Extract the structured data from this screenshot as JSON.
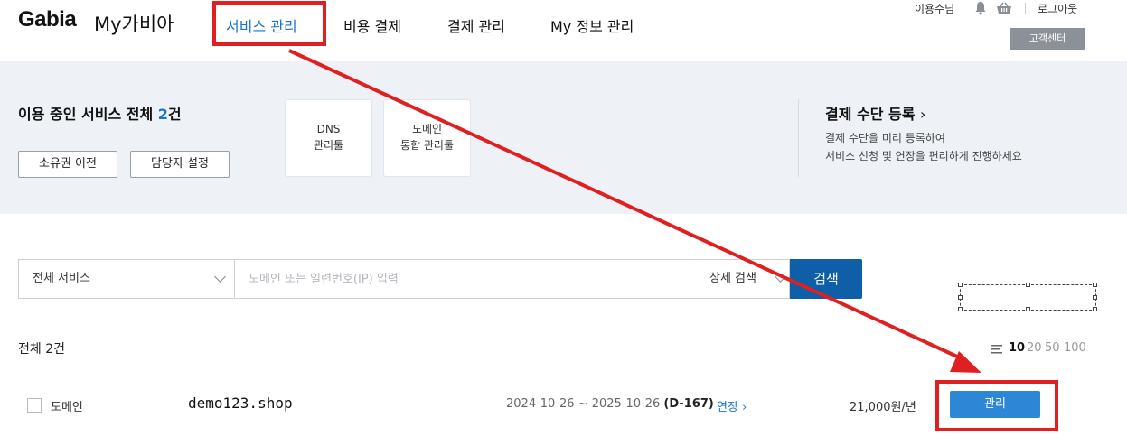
{
  "header": {
    "logo": "Gabia",
    "logo_sub": "My가비아",
    "nav": [
      {
        "label": "서비스 관리",
        "active": true
      },
      {
        "label": "비용 결제",
        "active": false
      },
      {
        "label": "결제 관리",
        "active": false
      },
      {
        "label": "My 정보 관리",
        "active": false
      }
    ],
    "user_name": "이용수님",
    "icons": [
      "bell-icon",
      "basket-icon"
    ],
    "logout": "로그아웃",
    "customer_center": "고객센터"
  },
  "summary": {
    "title_prefix": "이용 중인 서비스 전체 ",
    "count": "2",
    "title_suffix": "건",
    "buttons": [
      "소유권 이전",
      "담당자 설정"
    ],
    "tiles": [
      {
        "line1": "DNS",
        "line2": "관리툴"
      },
      {
        "line1": "도메인",
        "line2": "통합 관리툴"
      }
    ],
    "payment": {
      "title": "결제 수단 등록",
      "desc_line1": "결제 수단을 미리 등록하여",
      "desc_line2": "서비스 신청 및 연장을 편리하게 진행하세요"
    }
  },
  "search": {
    "service_select": "전체 서비스",
    "placeholder": "도메인 또는 일련번호(IP) 입력",
    "advanced": "상세 검색",
    "button": "검색"
  },
  "list": {
    "total": "전체 2건",
    "page_sizes": [
      "10",
      "20",
      "50",
      "100"
    ],
    "selected_page_size": "10",
    "rows": [
      {
        "type": "도메인",
        "domain": "demo123.shop",
        "period": "2024-10-26 ~ 2025-10-26",
        "dday": "(D-167)",
        "extend": "연장",
        "price": "21,000원/년",
        "action": "관리"
      }
    ]
  },
  "colors": {
    "accent": "#1a73c8",
    "primary_button": "#0f5ea8",
    "manage_button": "#2e86d6",
    "annotation": "#e02020",
    "band_bg": "#eef1f6"
  }
}
